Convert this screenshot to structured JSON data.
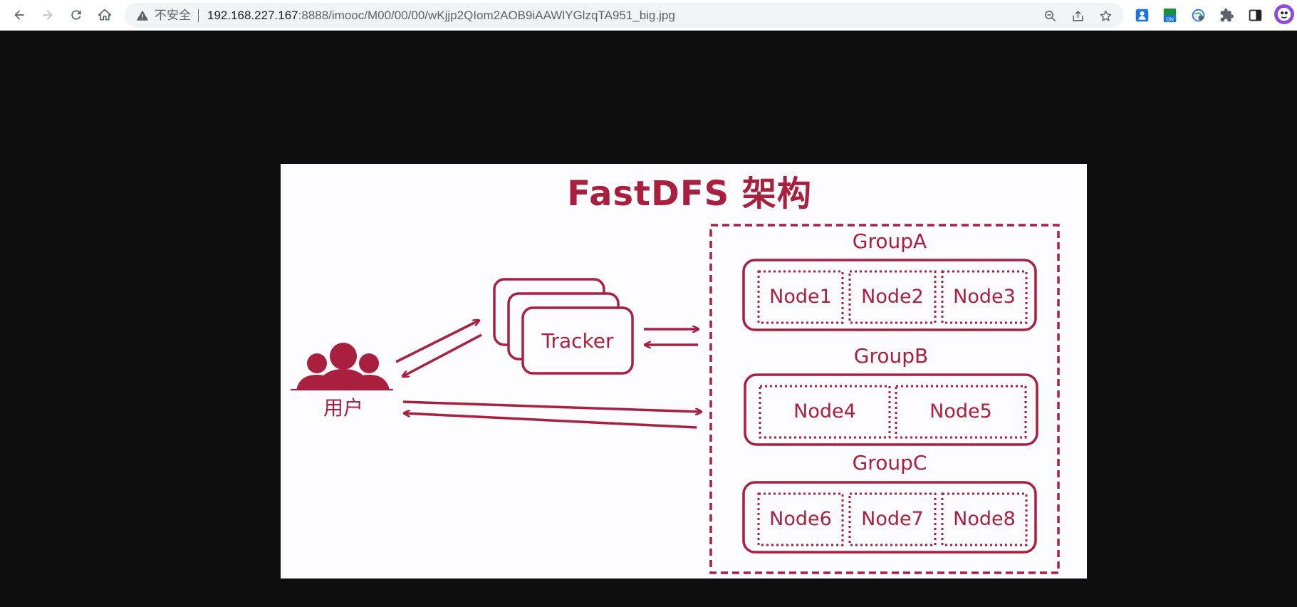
{
  "browser": {
    "security_label": "不安全",
    "url_host": "192.168.227.167",
    "url_path": ":8888/imooc/M00/00/00/wKjjp2QIom2AOB9iAAWlYGlzqTA951_big.jpg",
    "icons": [
      "back-arrow",
      "forward-arrow",
      "reload",
      "home",
      "warning-triangle",
      "zoom",
      "share",
      "star",
      "extension-1",
      "extension-on",
      "extension-globe",
      "puzzle",
      "side-panel",
      "profile-avatar"
    ],
    "ext_badge": "ON"
  },
  "image": {
    "title": "FastDFS 架构",
    "user_label": "用户",
    "tracker_label": "Tracker",
    "accent_color": "#a8203e",
    "groups": [
      {
        "name": "GroupA",
        "nodes": [
          "Node1",
          "Node2",
          "Node3"
        ]
      },
      {
        "name": "GroupB",
        "nodes": [
          "Node4",
          "Node5"
        ]
      },
      {
        "name": "GroupC",
        "nodes": [
          "Node6",
          "Node7",
          "Node8"
        ]
      }
    ]
  }
}
